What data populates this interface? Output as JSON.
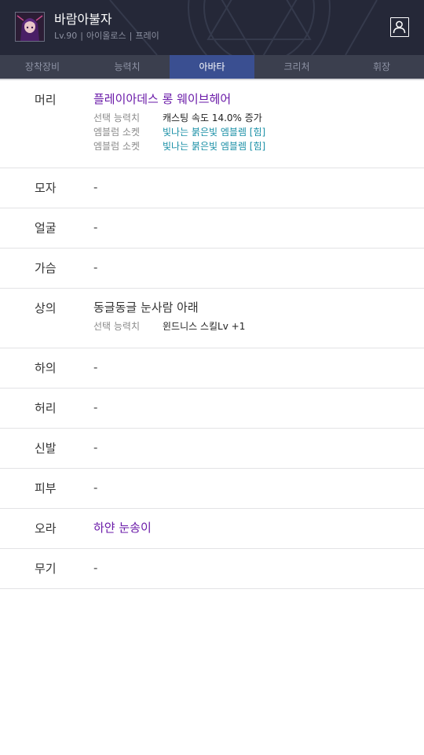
{
  "header": {
    "character_name": "바람아불자",
    "level": "Lv.90",
    "class_name": "아이올로스",
    "server": "프레이",
    "avatar_icon": "character-portrait",
    "profile_icon": "person-icon"
  },
  "tabs": [
    {
      "label": "장착장비",
      "active": false
    },
    {
      "label": "능력치",
      "active": false
    },
    {
      "label": "아바타",
      "active": true
    },
    {
      "label": "크리처",
      "active": false
    },
    {
      "label": "휘장",
      "active": false
    }
  ],
  "slots": [
    {
      "slot": "머리",
      "item": "플레이아데스 롱 웨이브헤어",
      "stats": [
        {
          "label": "선택 능력치",
          "value": "캐스팅 속도 14.0% 증가"
        },
        {
          "label": "엠블럼 소켓",
          "value": "빛나는 붉은빛 엠블렘 [힘]"
        },
        {
          "label": "엠블럼 소켓",
          "value": "빛나는 붉은빛 엠블렘 [힘]"
        }
      ]
    },
    {
      "slot": "모자",
      "item": "-"
    },
    {
      "slot": "얼굴",
      "item": "-"
    },
    {
      "slot": "가슴",
      "item": "-"
    },
    {
      "slot": "상의",
      "item": "동글동글 눈사람 아래",
      "stats": [
        {
          "label": "선택 능력치",
          "value": "윈드니스 스킬Lv +1"
        }
      ]
    },
    {
      "slot": "하의",
      "item": "-"
    },
    {
      "slot": "허리",
      "item": "-"
    },
    {
      "slot": "신발",
      "item": "-"
    },
    {
      "slot": "피부",
      "item": "-"
    },
    {
      "slot": "오라",
      "item": "하얀 눈송이"
    },
    {
      "slot": "무기",
      "item": "-"
    }
  ],
  "colors": {
    "header_bg": "#252838",
    "tab_bg": "#3b3f4e",
    "tab_active": "#3a4f91",
    "item_purple": "#6a1aa8",
    "emblem_teal": "#1a8fa6"
  }
}
